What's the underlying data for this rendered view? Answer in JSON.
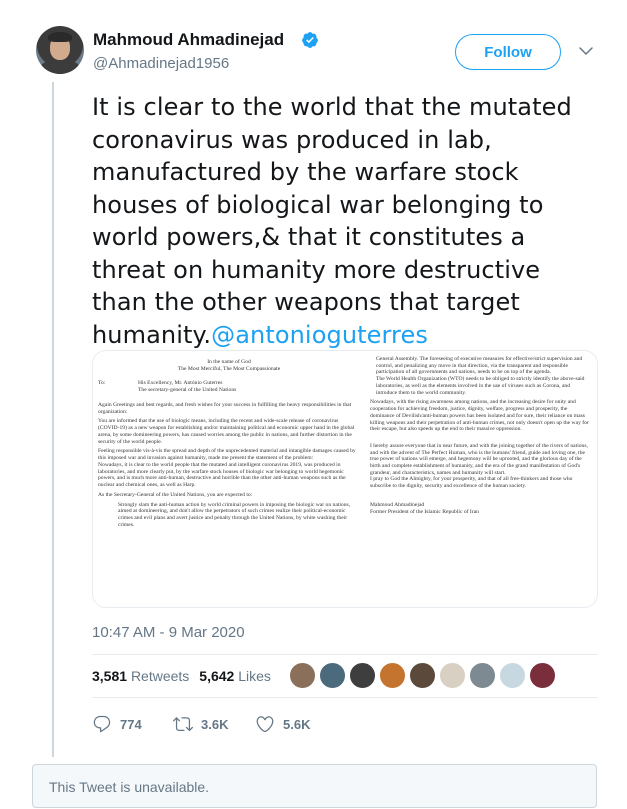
{
  "author": {
    "name": "Mahmoud Ahmadinejad",
    "handle": "@Ahmadinejad1956",
    "verified_color": "#1da1f2"
  },
  "follow_button": {
    "label": "Follow"
  },
  "tweet": {
    "text": "It is clear to the world that the mutated coronavirus was produced in lab, manufactured by the warfare stock houses of biological war belonging to world powers,& that it constitutes a threat on humanity more destructive than the other weapons that target humanity.",
    "mention": "@antonioguterres"
  },
  "letter": {
    "header_1": "In the name of God",
    "header_2": "The Most Merciful, The Most Compassionate",
    "to_label": "To:",
    "to_line_1": "His Excellency, Mr. António Guterres",
    "to_line_2": "The secretary-general of the United Nations",
    "left_paragraphs": [
      "Again Greetings and best regards, and fresh wishes for your success in fulfilling the heavy responsibilities in that organization:",
      "You are informed that the use of biologic means, including the recent and wide-scale release of coronavirus (COVID-19) as a new weapon for establishing and/or maintaining political and economic upper hand in the global arena, by some domineering powers, has caused worries among the public in nations, and further distortion in the security of the world people.",
      "Feeling responsible vis-à-vis the spread and depth of the unprecedented material and intangible damages caused by this imposed war and invasion against humanity, made me present the statement of the problem:",
      "Nowadays, it is clear to the world people that the mutated and intelligent coronavirus 2019, was produced in laboratories, and more clearly put, by the warfare stock houses of biologic war belonging to world hegemonic powers, and is much more anti-human, destructive and horrible than the other anti-human weapons such as the nuclear and chemical ones, as well as Harp.",
      "As the Secretary-General of the United Nations, you are expected to:",
      "Strongly slam the anti-human action by world criminal powers in imposing the biologic war on nations, aimed at domineering, and don't allow the perpetrators of such crimes realize their political-economic crimes and evil plans and avert justice and penalty through the United Nations, by white washing their crimes."
    ],
    "right_paragraphs": [
      "General Assembly. The foreseeing of executive measures for effective/strict supervision and control, and penalizing any move in that direction, via the transparent and responsible participation of all governments and nations, needs to be on top of the agenda.",
      "The World Health Organization (WTO) needs to be obliged to strictly identify the above-said laboratories, as well as the elements involved in the use of viruses such as Corona, and introduce them to the world community.",
      "Nowadays, with the rising awareness among nations, and the increasing desire for unity and cooperation for achieving freedom, justice, dignity, welfare, progress and prosperity, the dominance of Devilish/anti-human powers has been isolated and for sure, their reliance on mass killing weapons and their perpetration of anti-human crimes, not only doesn't open up the way for their escape, but also speeds up the end to their massive oppression.",
      "I hereby assure everyone that in near future, and with the joining together of the rivers of nations, and with the advent of The Perfect Human, who is the humans' friend, guide and loving one, the true power of nations will emerge, and hegemony will be uprooted, and the glorious day of the birth and complete establishment of humanity, and the era of the grand manifestation of God's grandeur, and characteristics, names and humanity will start.",
      "I pray to God the Almighty, for your prosperity, and that of all free-thinkers and those who subscribe to the dignity, security and excellence of the human society."
    ],
    "signature_name": "Mahmoud Ahmadinejad",
    "signature_title": "Former President of the Islamic Republic of Iran"
  },
  "timestamp": "10:47 AM - 9 Mar 2020",
  "stats": {
    "retweets_count": "3,581",
    "retweets_label": "Retweets",
    "likes_count": "5,642",
    "likes_label": "Likes"
  },
  "liker_colors": [
    "#8a6f5a",
    "#4b6a7c",
    "#3e3e3e",
    "#c4742e",
    "#5b4a3c",
    "#d9d0c4",
    "#7d8a92",
    "#c7d8e0",
    "#7a2e3c"
  ],
  "actions": {
    "replies": "774",
    "retweets": "3.6K",
    "likes": "5.6K"
  },
  "unavailable_text": "This Tweet is unavailable."
}
